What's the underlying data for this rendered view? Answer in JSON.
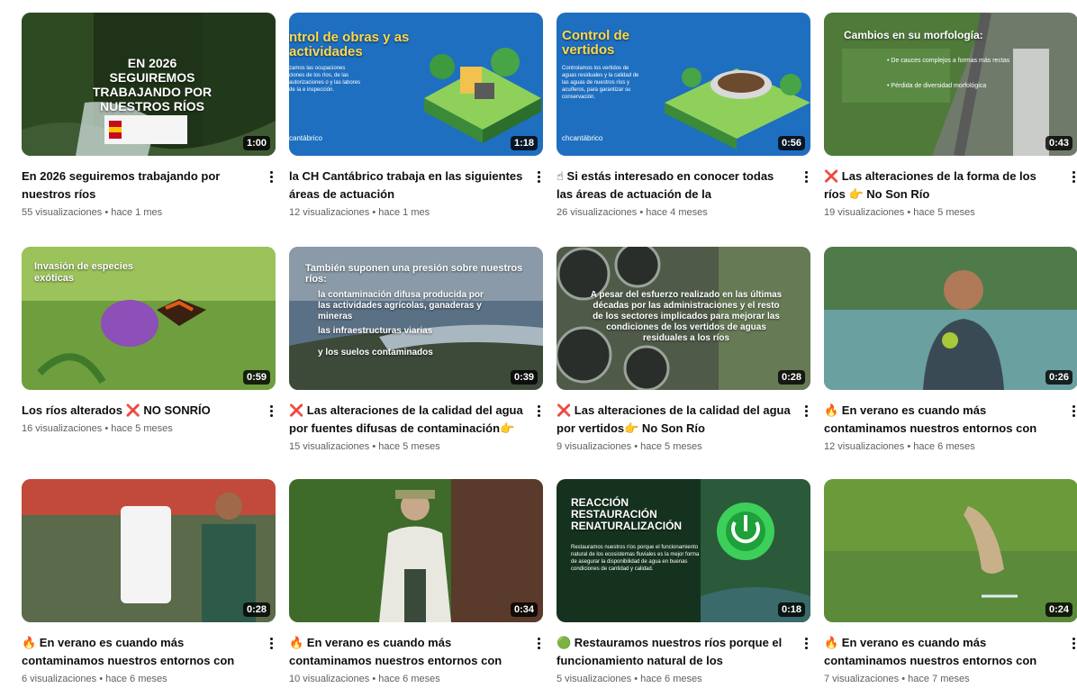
{
  "videos": [
    {
      "title": "En 2026 seguiremos trabajando por nuestros ríos",
      "meta": "55 visualizaciones • hace 1 mes",
      "duration": "1:00",
      "overlay": "EN 2026 SEGUIREMOS TRABAJANDO POR NUESTROS RÍOS"
    },
    {
      "title": "la CH Cantábrico trabaja en las siguientes áreas de actuación",
      "meta": "12 visualizaciones • hace 1 mes",
      "duration": "1:18",
      "overlay": "ntrol de obras y as actividades"
    },
    {
      "title": "☝ Si estás interesado en conocer todas las áreas de actuación de la Confederación...",
      "meta": "26 visualizaciones • hace 4 meses",
      "duration": "0:56",
      "overlay": "Control de vertidos"
    },
    {
      "title": "❌ Las alteraciones de la forma de los ríos 👉 No Son Río",
      "meta": "19 visualizaciones • hace 5 meses",
      "duration": "0:43",
      "overlay": "Cambios en su morfología:"
    },
    {
      "title": "Los ríos alterados ❌ NO SONRÍO",
      "meta": "16 visualizaciones • hace 5 meses",
      "duration": "0:59",
      "overlay": "Invasión de especies exóticas"
    },
    {
      "title": "❌ Las alteraciones de la calidad del agua por fuentes difusas de contaminación👉 N...",
      "meta": "15 visualizaciones • hace 5 meses",
      "duration": "0:39",
      "overlay": "También suponen una presión sobre nuestros ríos:"
    },
    {
      "title": "❌ Las alteraciones de la calidad del agua por vertidos👉 No Son Río",
      "meta": "9 visualizaciones • hace 5 meses",
      "duration": "0:28",
      "overlay": "A pesar del esfuerzo realizado en las últimas décadas por las administraciones y el resto de los sectores implicados para mejorar las condiciones de los vertidos de aguas residuales a los ríos"
    },
    {
      "title": "🔥 En verano es cuando más contaminamos nuestros entornos con basuraleza 🧨 ⚠",
      "meta": "12 visualizaciones • hace 6 meses",
      "duration": "0:26",
      "overlay": ""
    },
    {
      "title": "🔥 En verano es cuando más contaminamos nuestros entornos con basuraleza 🧨 ⚠",
      "meta": "6 visualizaciones • hace 6 meses",
      "duration": "0:28",
      "overlay": ""
    },
    {
      "title": "🔥 En verano es cuando más contaminamos nuestros entornos con basuraleza 🧨 ⚠",
      "meta": "10 visualizaciones • hace 6 meses",
      "duration": "0:34",
      "overlay": ""
    },
    {
      "title": "🟢 Restauramos nuestros ríos porque el funcionamiento natural de los ecosistemas...",
      "meta": "5 visualizaciones • hace 6 meses",
      "duration": "0:18",
      "overlay": "REACCIÓN RESTAURACIÓN RENATURALIZACIÓN"
    },
    {
      "title": "🔥 En verano es cuando más contaminamos nuestros entornos con basuraleza 🧨 ⚠",
      "meta": "7 visualizaciones • hace 7 meses",
      "duration": "0:24",
      "overlay": ""
    }
  ],
  "thumb_texts": {
    "v2_sub": "zamos las ocupaciones ciones de los ríos, de las autorizaciones o y las labores de ía e inspección.",
    "v2_brand": "cantábrico",
    "v3_sub": "Controlamos los vertidos de aguas residuales y la calidad de las aguas de nuestros ríos y acuíferos, para garantizar su conservación.",
    "v3_brand": "chcantábrico",
    "v4_b1": "• De cauces complejos a formas más rectas",
    "v4_b2": "• Pérdida de diversidad morfológica",
    "v6_l1": "la contaminación difusa producida por las actividades agrícolas, ganaderas y mineras",
    "v6_l2": "las infraestructuras viarias",
    "v6_l3": "y los suelos contaminados",
    "v11_sub": "Restauramos nuestros ríos porque el funcionamiento natural de los ecosistemas fluviales es la mejor forma de asegurar la disponibilidad de agua en buenas condiciones de cantidad y calidad."
  }
}
